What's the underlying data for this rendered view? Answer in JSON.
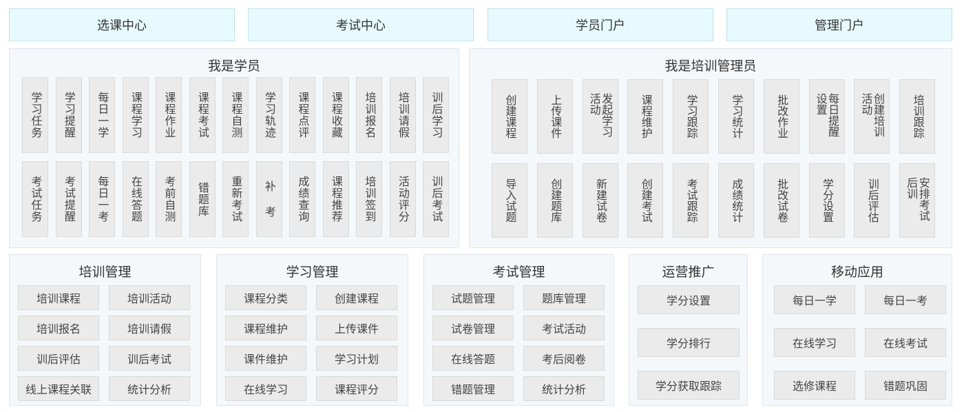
{
  "nav": [
    "选课中心",
    "考试中心",
    "学员门户",
    "管理门户"
  ],
  "student": {
    "title": "我是学员",
    "row1": [
      "学习任务",
      "学习提醒",
      "每日一学",
      "课程学习",
      "课程作业",
      "课程考试",
      "课程自测",
      "学习轨迹",
      "课程点评",
      "课程收藏",
      "培训报名",
      "培训请假",
      "训后学习"
    ],
    "row2": [
      "考试任务",
      "考试提醒",
      "每日一考",
      "在线答题",
      "考前自测",
      "错题库",
      "重新考试",
      "补 考",
      "成绩查询",
      "课程推荐",
      "培训签到",
      "活动评分",
      "训后考试"
    ]
  },
  "admin": {
    "title": "我是培训管理员",
    "row1": [
      "创建课程",
      "上传课件",
      "发起学习活动",
      "课程维护",
      "学习跟踪",
      "学习统计",
      "批改作业",
      "每日提醒设置",
      "创建培训活动",
      "培训跟踪"
    ],
    "row2": [
      "导入试题",
      "创建题库",
      "新建试卷",
      "创建考试",
      "考试跟踪",
      "成绩统计",
      "批改试卷",
      "学分设置",
      "训后评估",
      "安排考试后训"
    ]
  },
  "training": {
    "title": "培训管理",
    "items": [
      "培训课程",
      "培训活动",
      "培训报名",
      "培训请假",
      "训后评估",
      "训后考试",
      "线上课程关联",
      "统计分析"
    ]
  },
  "learning": {
    "title": "学习管理",
    "items": [
      "课程分类",
      "创建课程",
      "课程维护",
      "上传课件",
      "课件维护",
      "学习计划",
      "在线学习",
      "课程评分"
    ]
  },
  "exam": {
    "title": "考试管理",
    "items": [
      "试题管理",
      "题库管理",
      "试卷管理",
      "考试活动",
      "在线答题",
      "考后阅卷",
      "错题管理",
      "统计分析"
    ]
  },
  "ops": {
    "title": "运营推广",
    "items": [
      "学分设置",
      "学分排行",
      "学分获取跟踪"
    ]
  },
  "mobile": {
    "title": "移动应用",
    "items": [
      "每日一学",
      "每日一考",
      "在线学习",
      "在线考试",
      "选修课程",
      "错题巩固"
    ]
  }
}
